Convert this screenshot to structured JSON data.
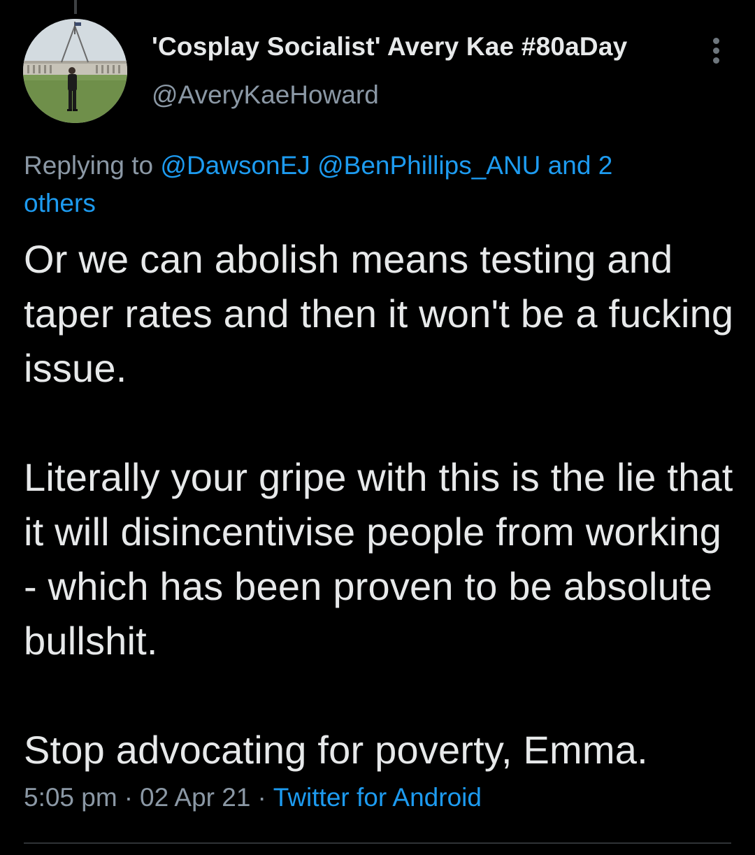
{
  "tweet": {
    "author": {
      "display_name": "'Cosplay Socialist' Avery Kae #80aDay",
      "handle": "@AveryKaeHoward"
    },
    "reply_to": {
      "prefix": "Replying to",
      "mentions": [
        "@DawsonEJ",
        "@BenPhillips_ANU"
      ],
      "others_prefix": "and 2",
      "others_suffix": "others"
    },
    "text": {
      "paragraph_1": "Or we can abolish means testing and taper rates and then it won't be a fucking issue.",
      "paragraph_2": "Literally your gripe with this is the lie that it will disincentivise people from working - which has been proven to be absolute bullshit.",
      "paragraph_3": "Stop advocating for poverty, Emma."
    },
    "meta": {
      "time": "5:05 pm",
      "date": "02 Apr 21",
      "source": "Twitter for Android",
      "separator": "·"
    }
  },
  "colors": {
    "background": "#000000",
    "text_primary": "#e7e9ea",
    "text_secondary": "#8b98a5",
    "link": "#1d9bf0",
    "divider": "#2f3336"
  },
  "icons": {
    "more": "more-vertical-icon"
  }
}
